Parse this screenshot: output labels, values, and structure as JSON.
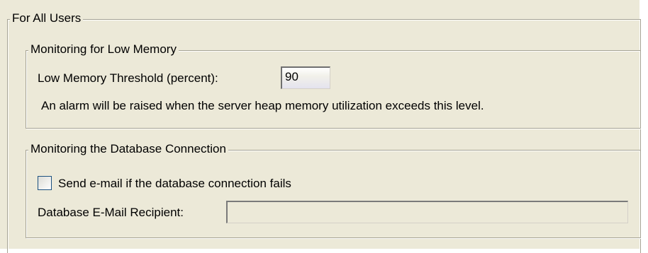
{
  "for_all_users": {
    "title": "For All Users"
  },
  "low_memory": {
    "title": "Monitoring for Low Memory",
    "threshold_label": "Low Memory Threshold (percent):",
    "threshold_value": "90",
    "description": "An alarm will be raised when the server heap memory utilization exceeds this level."
  },
  "database": {
    "title": "Monitoring the Database Connection",
    "send_email_label": "Send e-mail if the database connection fails",
    "send_email_checked": false,
    "recipient_label": "Database E-Mail Recipient:",
    "recipient_value": ""
  }
}
